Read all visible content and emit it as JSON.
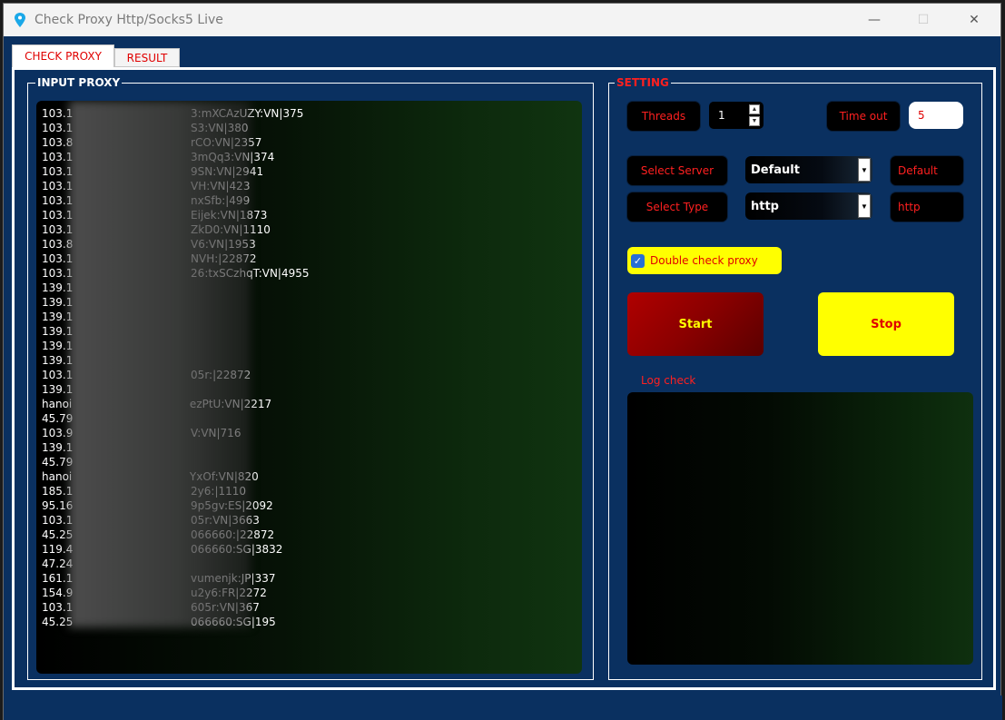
{
  "window": {
    "title": "Check Proxy Http/Socks5 Live",
    "minimize": "—",
    "maximize": "☐",
    "close": "✕"
  },
  "tabs": [
    {
      "label": "CHECK PROXY"
    },
    {
      "label": "RESULT"
    }
  ],
  "input": {
    "legend": "INPUT PROXY",
    "lines": [
      "103.1                                  3:mXCAzUZY:VN|375",
      "103.1                                  S3:VN|380",
      "103.8                                  rCO:VN|2357",
      "103.1                                  3mQq3:VN|374",
      "103.1                                  9SN:VN|2941",
      "103.1                                  VH:VN|423",
      "103.1                                  nxSfb:|499",
      "103.1                                  Eijek:VN|1873",
      "103.1                                  ZkD0:VN|1110",
      "103.8                                  V6:VN|1953",
      "103.1                                  NVH:|22872",
      "103.1                                  26:txSCzhqT:VN|4955",
      "139.1",
      "139.1",
      "139.1",
      "139.1",
      "139.1",
      "139.1",
      "103.1                                  05r:|22872",
      "139.1",
      "hanoi                                  ezPtU:VN|2217",
      "45.79",
      "103.9                                  V:VN|716",
      "139.1",
      "45.79",
      "hanoi                                  YxOf:VN|820",
      "185.1                                  2y6:|1110",
      "95.16                                  9p5gv:ES|2092",
      "103.1                                  05r:VN|3663",
      "45.25                                  066660:|22872",
      "119.4                                  066660:SG|3832",
      "47.24",
      "161.1                                  vumenjk:JP|337",
      "154.9                                  u2y6:FR|2272",
      "103.1                                  605r:VN|367",
      "45.25                                  066660:SG|195"
    ]
  },
  "setting": {
    "legend": "SETTING",
    "threads_label": "Threads",
    "threads_value": "1",
    "timeout_label": "Time out",
    "timeout_value": "5",
    "select_server_label": "Select Server",
    "server_selected": "Default",
    "server_display": "Default",
    "select_type_label": "Select Type",
    "type_selected": "http",
    "type_display": "http",
    "double_check_label": "Double check proxy",
    "double_check_checked": true,
    "start_label": "Start",
    "stop_label": "Stop",
    "log_label": "Log check"
  },
  "colors": {
    "background": "#0a3060",
    "accent_red": "#ff2020",
    "accent_yellow": "#ffff00"
  }
}
